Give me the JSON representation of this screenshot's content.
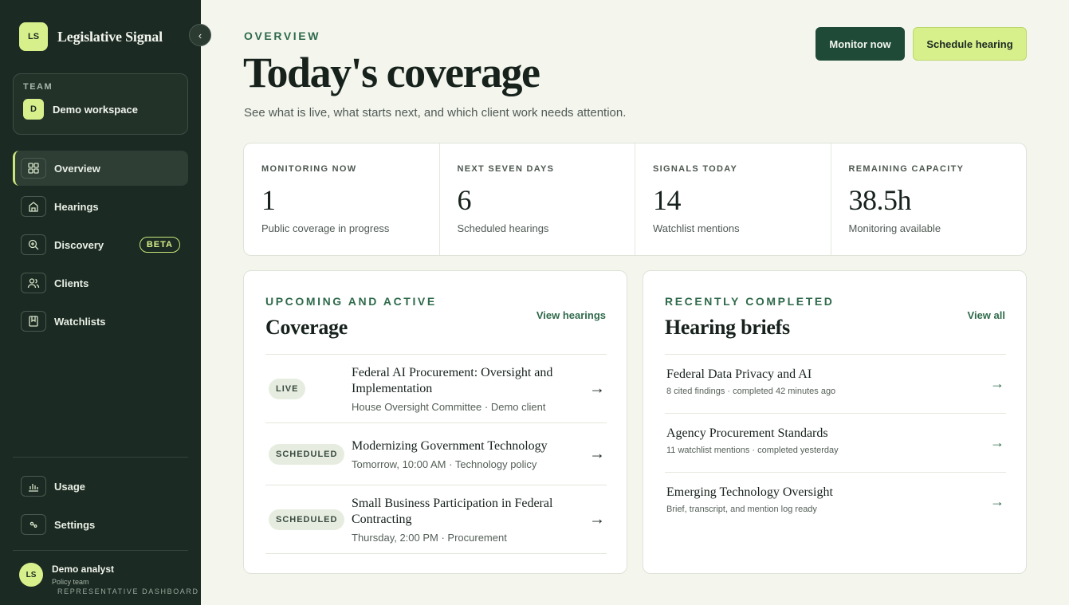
{
  "brand": {
    "logo": "LS",
    "name": "Legislative Signal"
  },
  "team": {
    "label": "TEAM",
    "avatar": "D",
    "name": "Demo workspace"
  },
  "nav": {
    "items": [
      {
        "label": "Overview",
        "icon": "grid-icon"
      },
      {
        "label": "Hearings",
        "icon": "building-icon"
      },
      {
        "label": "Discovery",
        "icon": "search-icon",
        "badge": "BETA"
      },
      {
        "label": "Clients",
        "icon": "users-icon"
      },
      {
        "label": "Watchlists",
        "icon": "bookmark-icon"
      }
    ],
    "bottom": [
      {
        "label": "Usage",
        "icon": "bar-chart-icon"
      },
      {
        "label": "Settings",
        "icon": "settings-icon"
      }
    ]
  },
  "profile": {
    "avatar": "LS",
    "name": "Demo analyst",
    "team": "Policy team",
    "footer": "REPRESENTATIVE DASHBOARD"
  },
  "header": {
    "eyebrow": "OVERVIEW",
    "title": "Today's coverage",
    "subtitle": "See what is live, what starts next, and which client work needs attention.",
    "primary_button": "Monitor now",
    "secondary_button": "Schedule hearing"
  },
  "stats": [
    {
      "label": "MONITORING NOW",
      "value": "1",
      "caption": "Public coverage in progress"
    },
    {
      "label": "NEXT SEVEN DAYS",
      "value": "6",
      "caption": "Scheduled hearings"
    },
    {
      "label": "SIGNALS TODAY",
      "value": "14",
      "caption": "Watchlist mentions"
    },
    {
      "label": "REMAINING CAPACITY",
      "value": "38.5h",
      "caption": "Monitoring available"
    }
  ],
  "coverage": {
    "eyebrow": "UPCOMING AND ACTIVE",
    "title": "Coverage",
    "link": "View hearings",
    "items": [
      {
        "status": "LIVE",
        "title": "Federal AI Procurement: Oversight and Implementation",
        "meta": "House Oversight Committee · Demo client"
      },
      {
        "status": "SCHEDULED",
        "title": "Modernizing Government Technology",
        "meta": "Tomorrow, 10:00 AM · Technology policy"
      },
      {
        "status": "SCHEDULED",
        "title": "Small Business Participation in Federal Contracting",
        "meta": "Thursday, 2:00 PM · Procurement"
      }
    ]
  },
  "briefs": {
    "eyebrow": "RECENTLY COMPLETED",
    "title": "Hearing briefs",
    "link": "View all",
    "items": [
      {
        "title": "Federal Data Privacy and AI",
        "meta": "8 cited findings · completed 42 minutes ago"
      },
      {
        "title": "Agency Procurement Standards",
        "meta": "11 watchlist mentions · completed yesterday"
      },
      {
        "title": "Emerging Technology Oversight",
        "meta": "Brief, transcript, and mention log ready"
      }
    ]
  },
  "arrow_glyph": "→",
  "collapse_glyph": "‹",
  "colors": {
    "sidebar": "#1b2a22",
    "accent": "#d8f08c",
    "primary": "#1f4a37",
    "eyebrow": "#2f6a4b"
  }
}
